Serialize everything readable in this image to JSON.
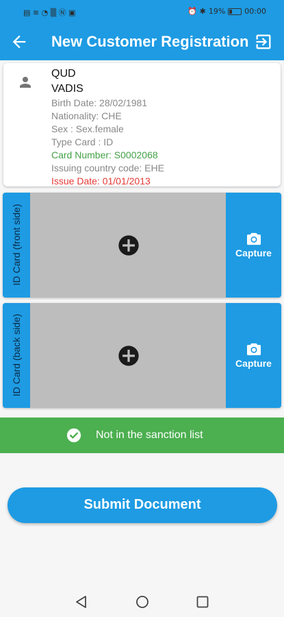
{
  "status_bar": {
    "left_glyphs": "▤ ≋ ◔ ▒ Ⓝ ▣",
    "right_glyphs": "⏰ ✱",
    "battery_percent": "19%",
    "time": "00:00"
  },
  "app_bar": {
    "title": "New Customer Registration",
    "back_icon": "arrow-back-icon",
    "logout_icon": "logout-icon"
  },
  "customer": {
    "first_name": "QUD",
    "last_name": "VADIS",
    "birth_date": "Birth Date: 28/02/1981",
    "nationality": "Nationality: CHE",
    "sex": "Sex : Sex.female",
    "type_card": "Type Card : ID",
    "card_number": "Card Number: S0002068",
    "issuing_country": "Issuing country code: EHE",
    "issue_date": "Issue Date: 01/01/2013"
  },
  "id_cards": {
    "front": {
      "label": "ID Card (front side)",
      "capture_label": "Capture"
    },
    "back": {
      "label": "ID Card (back side)",
      "capture_label": "Capture"
    }
  },
  "sanction": {
    "text": "Not in the sanction list",
    "status": "clear"
  },
  "submit": {
    "label": "Submit Document"
  },
  "colors": {
    "primary": "#1e9be3",
    "success": "#4caf50",
    "card_number": "#43a047",
    "issue_date": "#e53935"
  }
}
